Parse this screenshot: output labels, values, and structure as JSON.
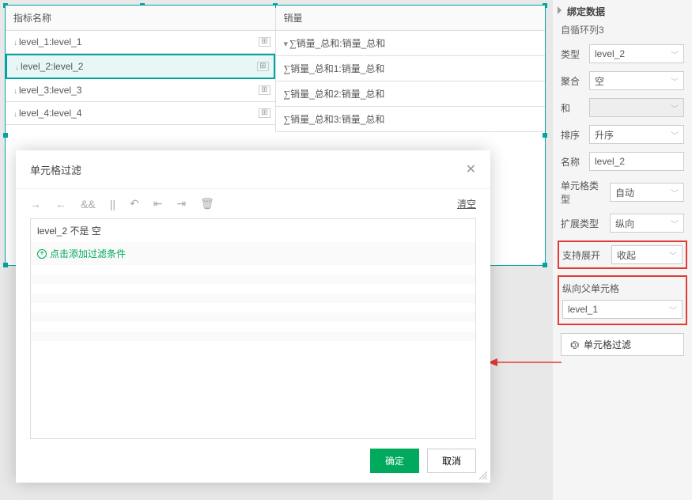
{
  "table": {
    "headers": {
      "name": "指标名称",
      "sales": "销量"
    },
    "rows": [
      {
        "name": "level_1:level_1",
        "sales": "销量_总和:销量_总和"
      },
      {
        "name": "level_2:level_2",
        "sales": "销量_总和1:销量_总和"
      },
      {
        "name": "level_3:level_3",
        "sales": "销量_总和2:销量_总和"
      },
      {
        "name": "level_4:level_4",
        "sales": "销量_总和3:销量_总和"
      }
    ]
  },
  "side": {
    "title": "绑定数据",
    "sub": "自循环列3",
    "fields": {
      "type": {
        "label": "类型",
        "value": "level_2"
      },
      "agg": {
        "label": "聚合",
        "value": "空"
      },
      "sum": {
        "label": "和",
        "value": ""
      },
      "sort": {
        "label": "排序",
        "value": "升序"
      },
      "name": {
        "label": "名称",
        "value": "level_2"
      },
      "cellType": {
        "label": "单元格类型",
        "value": "自动"
      },
      "expandType": {
        "label": "扩展类型",
        "value": "纵向"
      },
      "supportExpand": {
        "label": "支持展开",
        "value": "收起"
      },
      "parentCell": {
        "label": "纵向父单元格",
        "value": "level_1"
      }
    },
    "cellFilterBtn": "单元格过滤"
  },
  "modal": {
    "title": "单元格过滤",
    "clear": "清空",
    "condition": "level_2 不是 空",
    "addText": "点击添加过滤条件",
    "ok": "确定",
    "cancel": "取消"
  }
}
